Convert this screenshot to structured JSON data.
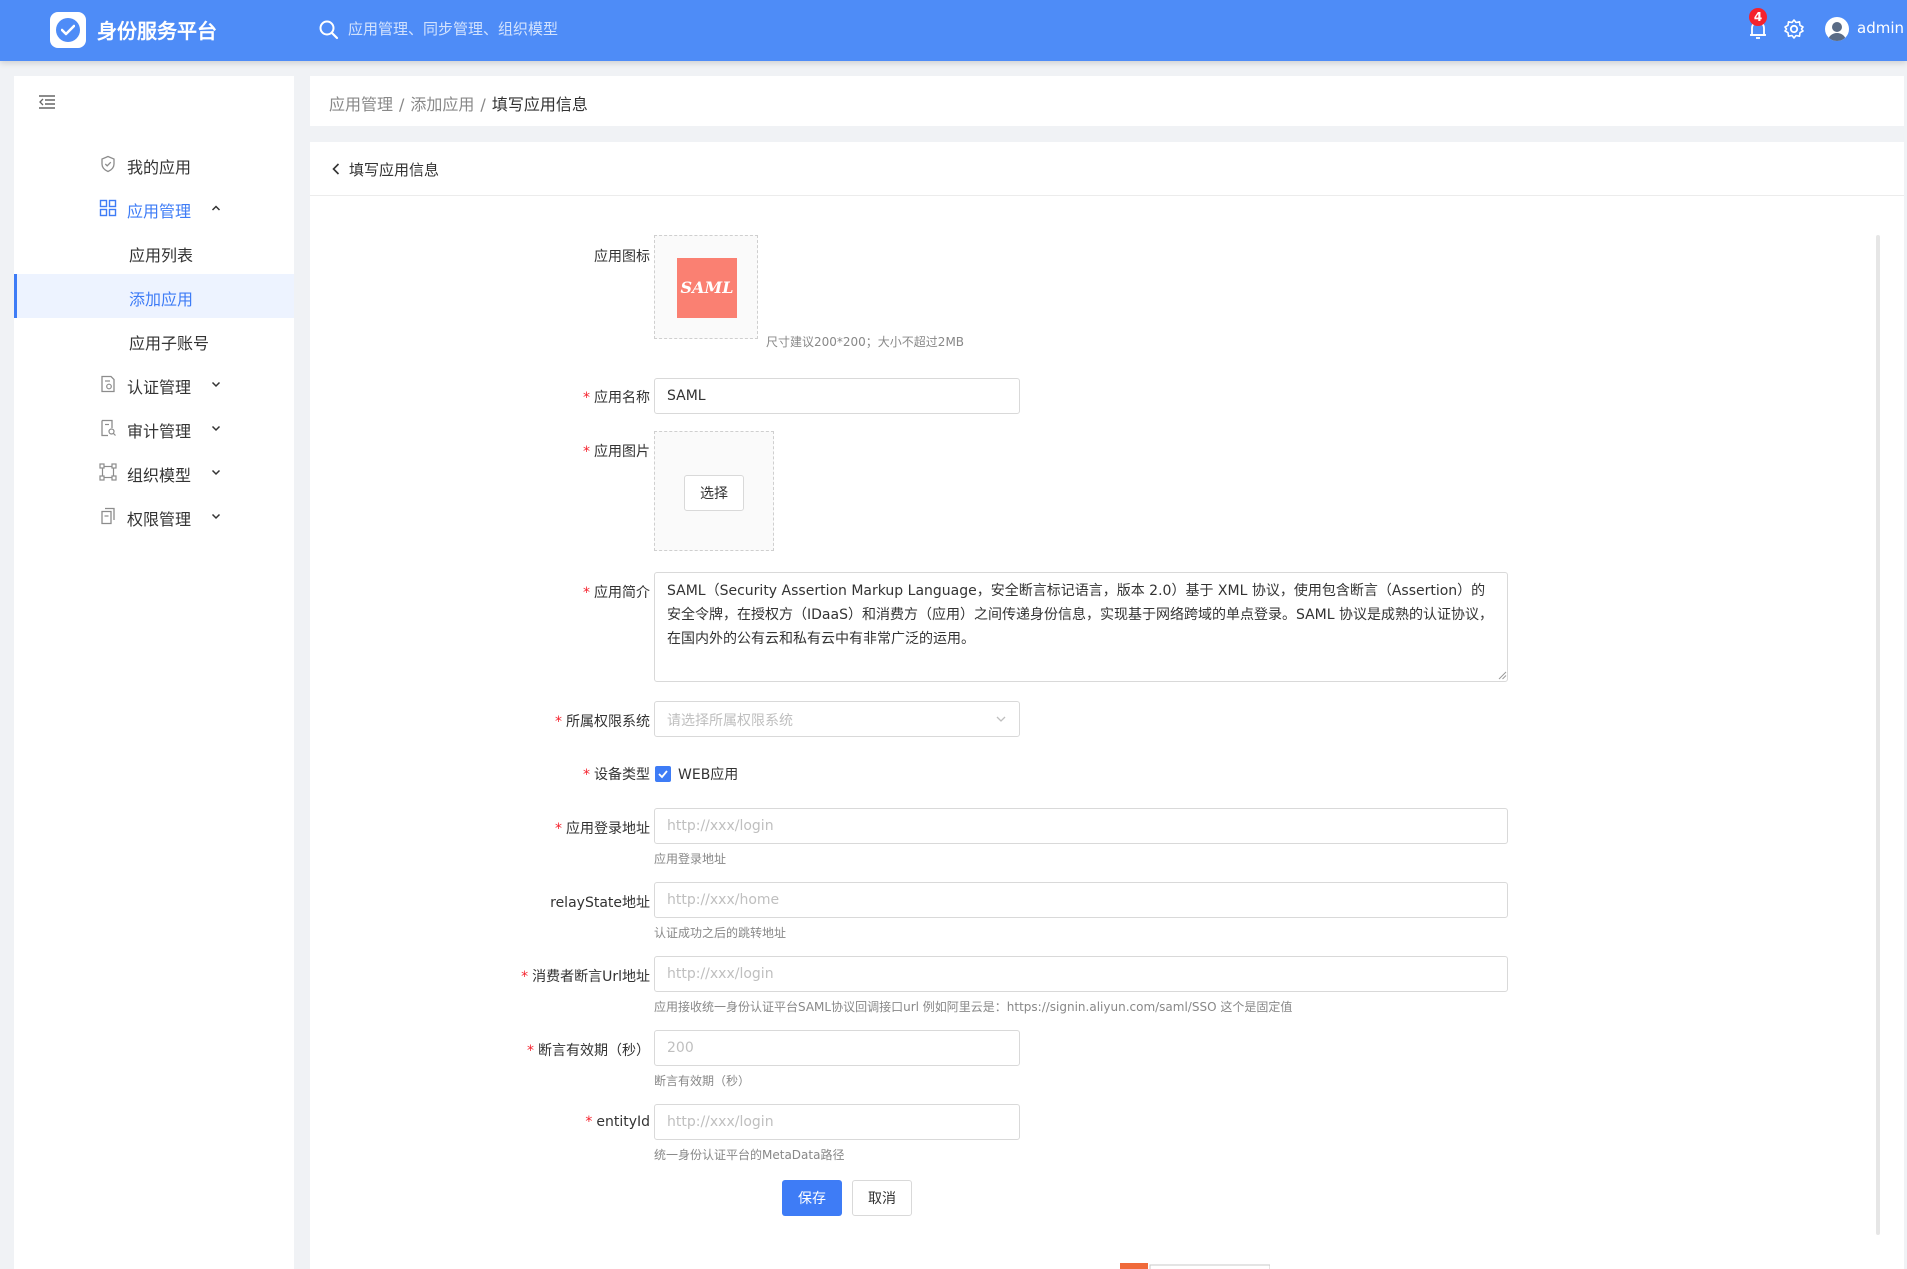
{
  "header": {
    "brand": "身份服务平台",
    "search_placeholder": "应用管理、同步管理、组织模型",
    "notification_count": "4",
    "username": "admin"
  },
  "sidebar": {
    "items": [
      {
        "label": "我的应用",
        "icon": "shield-icon"
      },
      {
        "label": "应用管理",
        "icon": "grid-icon",
        "expanded": true,
        "children": [
          {
            "label": "应用列表"
          },
          {
            "label": "添加应用",
            "selected": true
          },
          {
            "label": "应用子账号"
          }
        ]
      },
      {
        "label": "认证管理",
        "icon": "certificate-icon"
      },
      {
        "label": "审计管理",
        "icon": "audit-icon"
      },
      {
        "label": "组织模型",
        "icon": "org-icon"
      },
      {
        "label": "权限管理",
        "icon": "permission-icon"
      }
    ]
  },
  "breadcrumb": {
    "items": [
      "应用管理",
      "添加应用"
    ],
    "current": "填写应用信息",
    "separator": "/"
  },
  "panel": {
    "title": "填写应用信息"
  },
  "form": {
    "icon": {
      "label": "应用图标",
      "logo_text": "SAML",
      "help": "尺寸建议200*200；大小不超过2MB"
    },
    "name": {
      "label": "应用名称",
      "value": "SAML"
    },
    "picture": {
      "label": "应用图片",
      "button": "选择"
    },
    "description": {
      "label": "应用简介",
      "value": "SAML（Security Assertion Markup Language，安全断言标记语言，版本 2.0）基于 XML 协议，使用包含断言（Assertion）的安全令牌，在授权方（IDaaS）和消费方（应用）之间传递身份信息，实现基于网络跨域的单点登录。SAML 协议是成熟的认证协议，在国内外的公有云和私有云中有非常广泛的运用。"
    },
    "permission_system": {
      "label": "所属权限系统",
      "placeholder": "请选择所属权限系统"
    },
    "device_type": {
      "label": "设备类型",
      "option": "WEB应用",
      "checked": true
    },
    "login_url": {
      "label": "应用登录地址",
      "placeholder": "http://xxx/login",
      "help": "应用登录地址"
    },
    "relay_state": {
      "label": "relayState地址",
      "placeholder": "http://xxx/home",
      "help": "认证成功之后的跳转地址"
    },
    "acs_url": {
      "label": "消费者断言Url地址",
      "placeholder": "http://xxx/login",
      "help": "应用接收统一身份认证平台SAML协议回调接口url 例如阿里云是：https://signin.aliyun.com/saml/SSO 这个是固定值"
    },
    "assertion_validity": {
      "label": "断言有效期（秒）",
      "placeholder": "200",
      "help": "断言有效期（秒）"
    },
    "entity_id": {
      "label": "entityId",
      "placeholder": "http://xxx/login",
      "help": "统一身份认证平台的MetaData路径"
    },
    "save_label": "保存",
    "cancel_label": "取消"
  },
  "colors": {
    "header_bg": "#4e8cf7",
    "accent": "#3e7cf6",
    "required": "#f5222d",
    "saml_logo": "#fa8072"
  }
}
